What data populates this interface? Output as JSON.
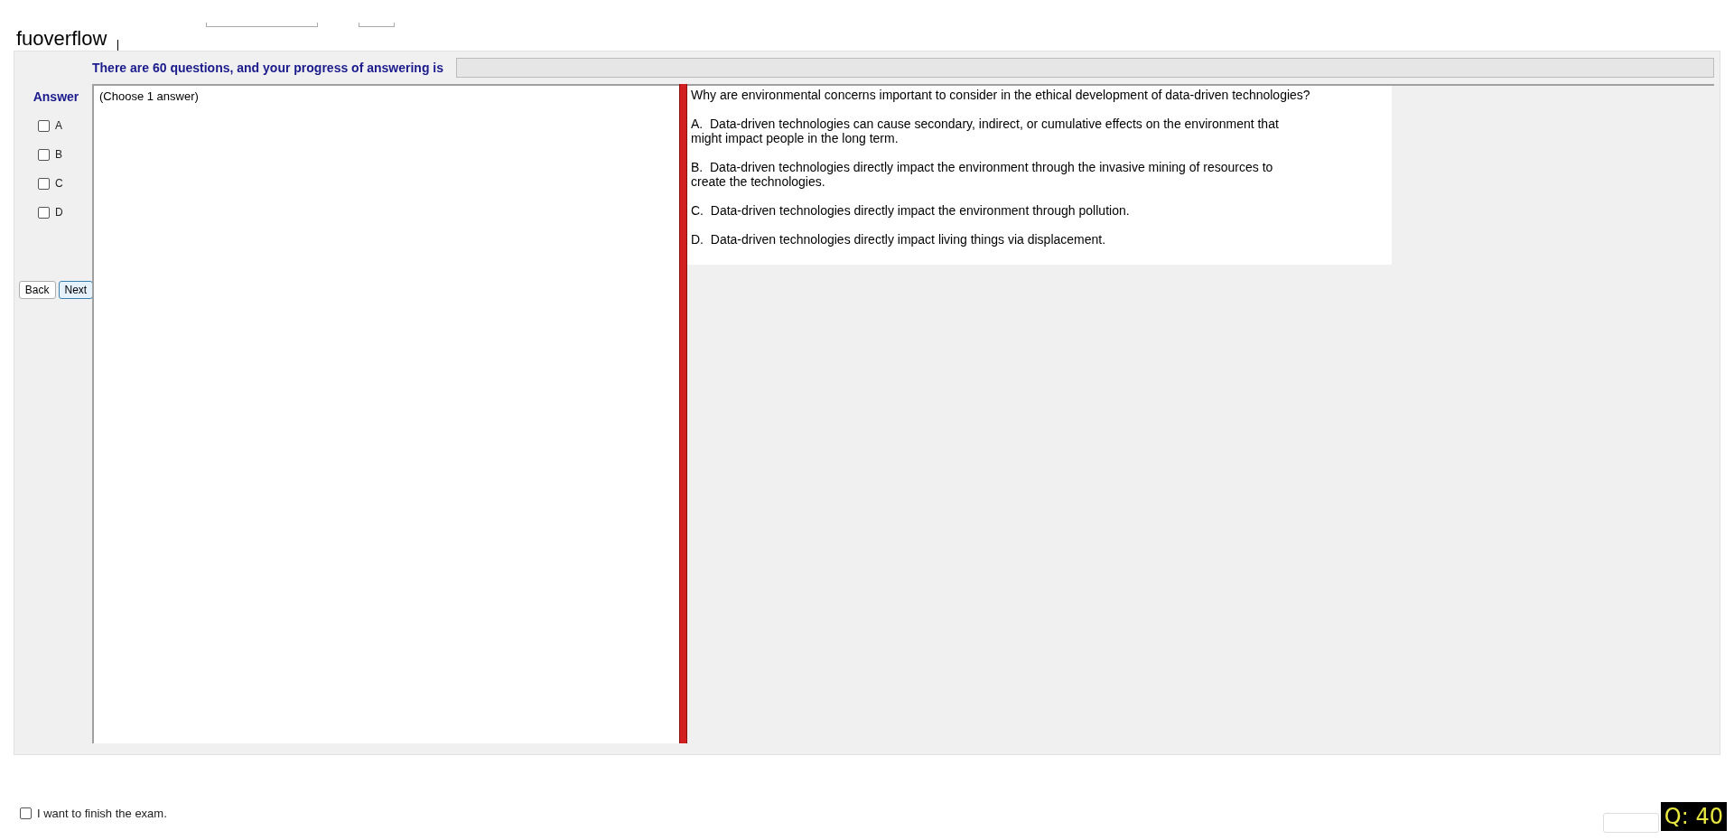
{
  "title": "fuoverflow",
  "progress": {
    "label": "There are 60 questions, and your progress of answering is",
    "level": 0
  },
  "answer": {
    "heading": "Answer",
    "options": [
      {
        "label": "A",
        "checked": false
      },
      {
        "label": "B",
        "checked": false
      },
      {
        "label": "C",
        "checked": false
      },
      {
        "label": "D",
        "checked": false
      }
    ]
  },
  "buttons": [
    {
      "label": "Back",
      "selected": false
    },
    {
      "label": "Next",
      "selected": true
    }
  ],
  "instruction": "(Choose 1 answer)",
  "question": {
    "text": "Why are environmental concerns important to consider in the ethical development of data-driven technologies?",
    "choices": [
      "A.  Data-driven technologies can cause secondary, indirect, or cumulative effects on the environment that\nmight impact people in the long term.",
      "B.  Data-driven technologies directly impact the environment through the invasive mining of resources to\ncreate the technologies.",
      "C.  Data-driven technologies directly impact the environment through pollution.",
      "D.  Data-driven technologies directly impact living things via displacement."
    ]
  },
  "finish": {
    "label": "I want to finish the exam.",
    "checked": false
  },
  "counter": "Q: 40"
}
